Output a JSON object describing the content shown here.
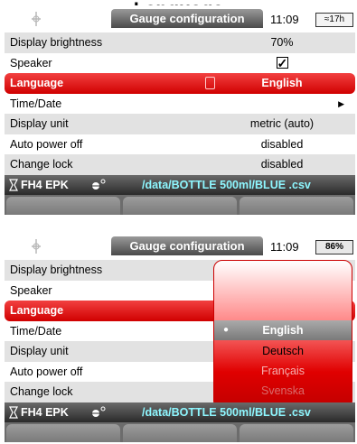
{
  "page": {
    "title": "Language"
  },
  "screens": [
    {
      "window_title": "Gauge configuration",
      "time": "11:09",
      "battery": "≈17h",
      "settings": [
        {
          "label": "Display brightness",
          "value": "70%"
        },
        {
          "label": "Speaker",
          "value": ""
        },
        {
          "label": "Language",
          "value": "English"
        },
        {
          "label": "Time/Date",
          "value": ""
        },
        {
          "label": "Display unit",
          "value": "metric (auto)"
        },
        {
          "label": "Auto power off",
          "value": "disabled"
        },
        {
          "label": "Change lock",
          "value": "disabled"
        }
      ],
      "device": "FH4 EPK",
      "file_path": "/data/BOTTLE 500ml/BLUE .csv"
    },
    {
      "window_title": "Gauge configuration",
      "time": "11:09",
      "battery": "86%",
      "settings": [
        {
          "label": "Display brightness"
        },
        {
          "label": "Speaker"
        },
        {
          "label": "Language"
        },
        {
          "label": "Time/Date"
        },
        {
          "label": "Display unit"
        },
        {
          "label": "Auto power off"
        },
        {
          "label": "Change lock"
        }
      ],
      "language_options": [
        "English",
        "Deutsch",
        "Français",
        "Svenska"
      ],
      "device": "FH4 EPK",
      "file_path": "/data/BOTTLE 500ml/BLUE .csv"
    }
  ],
  "icons": {
    "app_logo": "device-logo-icon",
    "speaker_checkbox": "checkbox-checked-icon",
    "language": "language-icon",
    "submenu": "chevron-right-icon",
    "device": "device-icon",
    "probe": "probe-icon",
    "selected_option": "bullet-icon"
  },
  "colors": {
    "selected_row": "#e00000",
    "file_path": "#8ef7ff",
    "title_tab": "#555555"
  }
}
